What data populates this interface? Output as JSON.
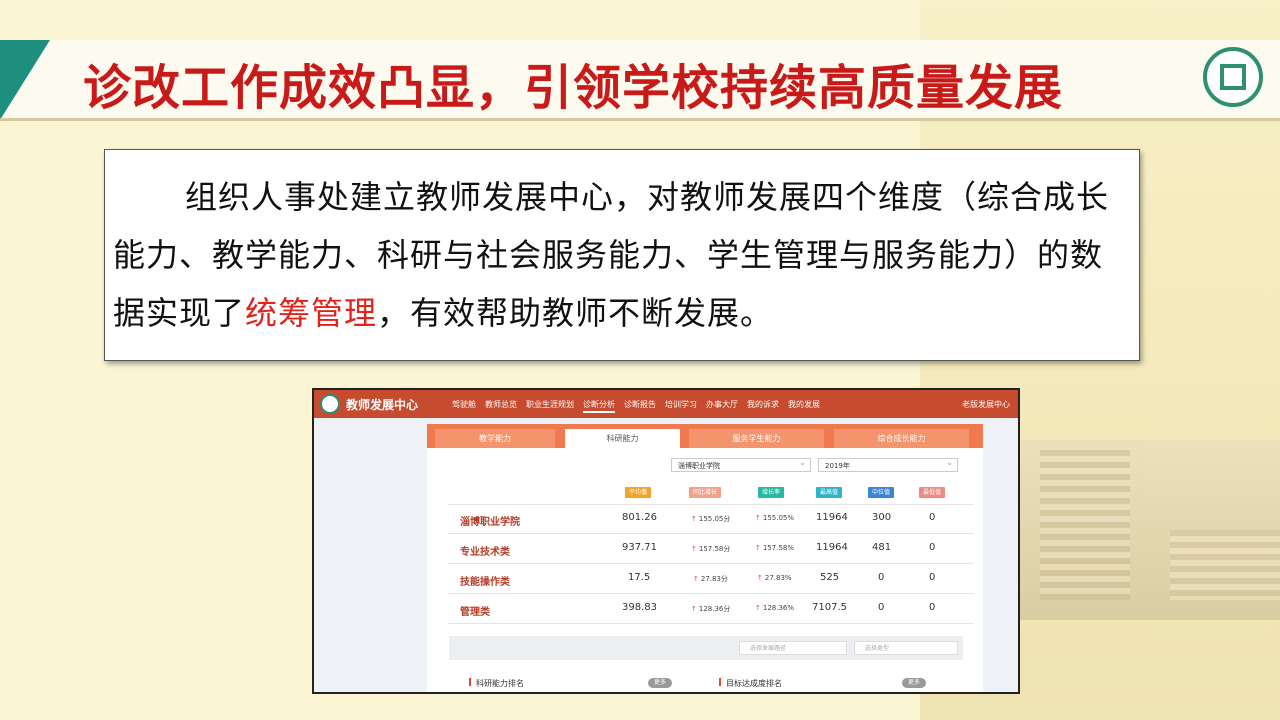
{
  "slide": {
    "title": "诊改工作成效凸显，引领学校持续高质量发展",
    "paragraph": {
      "part1": "组织人事处建立教师发展中心，对教师发展四个维度（综合成长能力、教学能力、科研与社会服务能力、学生管理与服务能力）的数据实现了",
      "highlight": "统筹管理",
      "part2": "，有效帮助教师不断发展。"
    },
    "colors": {
      "title": "#c91a1a",
      "accent": "#1e8f7c",
      "highlight": "#e0241c"
    }
  },
  "screenshot": {
    "brand": "教师发展中心",
    "menu": [
      "驾驶舱",
      "教师总览",
      "职业生涯规划",
      "诊断分析",
      "诊断报告",
      "培训学习",
      "办事大厅",
      "我的诉求",
      "我的发展"
    ],
    "active_menu": "诊断分析",
    "right_link": "老版发展中心",
    "tabs": [
      "教学能力",
      "科研能力",
      "服务学生能力",
      "综合成长能力"
    ],
    "active_tab": "科研能力",
    "filters": {
      "college": "淄博职业学院",
      "year": "2019年"
    },
    "columns": [
      "平均值",
      "同比增长",
      "增长率",
      "最高值",
      "中位值",
      "最低值"
    ],
    "rows": [
      {
        "name": "淄博职业学院",
        "avg": "801.26",
        "yoy": "155.05分",
        "rate": "155.05%",
        "max": "11964",
        "median": "300",
        "min": "0"
      },
      {
        "name": "专业技术类",
        "avg": "937.71",
        "yoy": "157.58分",
        "rate": "157.58%",
        "max": "11964",
        "median": "481",
        "min": "0"
      },
      {
        "name": "技能操作类",
        "avg": "17.5",
        "yoy": "27.83分",
        "rate": "27.83%",
        "max": "525",
        "median": "0",
        "min": "0"
      },
      {
        "name": "管理类",
        "avg": "398.83",
        "yoy": "128.36分",
        "rate": "128.36%",
        "max": "7107.5",
        "median": "0",
        "min": "0"
      }
    ],
    "bottom_selects": [
      "选择发展路径",
      "选择类型"
    ],
    "sections": [
      "科研能力排名",
      "目标达成度排名"
    ],
    "more_label": "更多"
  }
}
